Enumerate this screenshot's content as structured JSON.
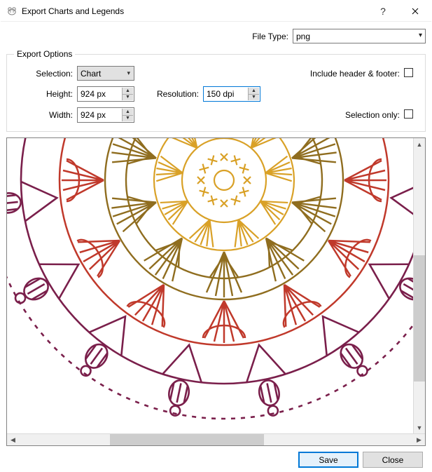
{
  "window": {
    "title": "Export Charts and Legends",
    "help_tooltip": "?",
    "close_tooltip": "Close"
  },
  "file_type": {
    "label": "File Type:",
    "value": "png"
  },
  "options": {
    "legend": "Export Options",
    "selection_label": "Selection:",
    "selection_value": "Chart",
    "height_label": "Height:",
    "height_value": "924 px",
    "width_label": "Width:",
    "width_value": "924 px",
    "resolution_label": "Resolution:",
    "resolution_value": "150 dpi",
    "include_header_footer_label": "Include header & footer:",
    "include_header_footer_checked": false,
    "selection_only_label": "Selection only:",
    "selection_only_checked": false
  },
  "footer": {
    "save_label": "Save",
    "close_label": "Close"
  },
  "colors": {
    "gold": "#d9a127",
    "olive": "#8f6d1f",
    "red": "#c0392b",
    "maroon": "#7a1f4b"
  }
}
